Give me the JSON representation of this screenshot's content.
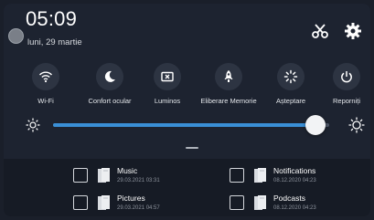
{
  "status": {
    "time": "05:09",
    "date": "luni, 29 martie"
  },
  "header_icons": [
    {
      "name": "scissors-icon"
    },
    {
      "name": "gear-icon"
    }
  ],
  "quick_tiles": [
    {
      "label": "Wi-Fi",
      "icon": "wifi-icon"
    },
    {
      "label": "Confort ocular",
      "icon": "moon-icon"
    },
    {
      "label": "Luminos",
      "icon": "screen-cast-icon"
    },
    {
      "label": "Eliberare Memorie",
      "icon": "rocket-icon"
    },
    {
      "label": "Așteptare",
      "icon": "loading-icon"
    },
    {
      "label": "Reporniți",
      "icon": "power-icon"
    }
  ],
  "brightness": {
    "level_percent": 95,
    "min_icon": "sun-small-icon",
    "max_icon": "sun-large-icon"
  },
  "files": [
    {
      "name": "Music",
      "date": "29.03.2021 03:31"
    },
    {
      "name": "Notifications",
      "date": "08.12.2020 04:23"
    },
    {
      "name": "Pictures",
      "date": "29.03.2021 04:57"
    },
    {
      "name": "Podcasts",
      "date": "08.12.2020 04:23"
    }
  ],
  "colors": {
    "accent": "#3a8fd6",
    "panel": "#1d2330",
    "tile": "#2d3442"
  }
}
